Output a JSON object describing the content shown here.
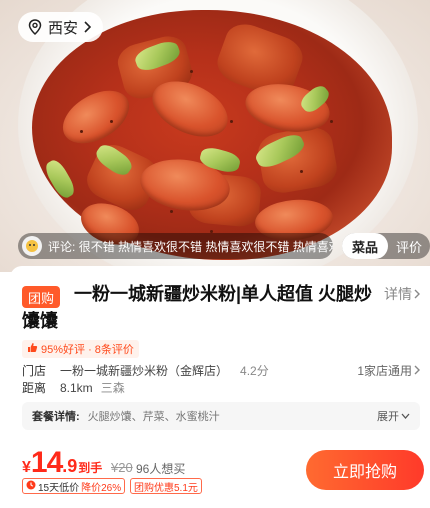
{
  "location": {
    "city": "西安"
  },
  "hero": {
    "comment_prefix": "评论:",
    "comment_text": "很不错 热情喜欢很不错 热情喜欢很不错 热情喜欢很不...",
    "tabs": [
      "菜品",
      "评价"
    ],
    "active_tab": "菜品"
  },
  "deal": {
    "tag": "团购",
    "title": "一粉一城新疆炒米粉|单人超值 火腿炒馕馕",
    "detail_link": "详情",
    "rating": "95%好评 · 8条评价",
    "store_label": "门店",
    "store_name": "一粉一城新疆炒米粉（金辉店）",
    "store_score": "4.2分",
    "stores_link": "1家店通用",
    "distance_label": "距离",
    "distance": "8.1km",
    "area": "三森",
    "combo_key": "套餐详情:",
    "combo_value": "火腿炒馕、芹菜、水蜜桃汁",
    "combo_more": "展开",
    "price_currency": "¥",
    "price_int": "14",
    "price_dec": ".9",
    "price_suffix": "到手",
    "original_price": "¥20",
    "want_count": "96人想买",
    "badge_low": "15天低价",
    "badge_drop": "降价26%",
    "badge_coupon": "团购优惠5.1元",
    "buy_label": "立即抢购"
  },
  "colors": {
    "accent": "#ff3a2a",
    "tag_bg": "#ff5a2a"
  }
}
